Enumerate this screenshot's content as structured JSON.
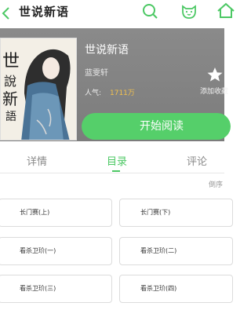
{
  "header": {
    "title": "世说新语"
  },
  "book": {
    "title": "世说新语",
    "author": "蓝雯轩",
    "popularity_label": "人气:",
    "popularity_value": "1711万",
    "favorite_label": "添加收藏",
    "cover_text": "世說新語"
  },
  "actions": {
    "read_label": "开始阅读"
  },
  "tabs": [
    {
      "label": "详情",
      "active": false
    },
    {
      "label": "目录",
      "active": true
    },
    {
      "label": "评论",
      "active": false
    }
  ],
  "toc": {
    "sort_label": "倒序",
    "chapters": [
      "长门赛(上)",
      "长门赛(下)",
      "看杀卫玠(一)",
      "看杀卫玠(二)",
      "看杀卫玠(三)",
      "看杀卫玠(四)"
    ]
  },
  "colors": {
    "accent": "#4cc864",
    "button": "#55cf6a",
    "popularity": "#f2c14e"
  },
  "icons": [
    "back-icon",
    "search-icon",
    "mascot-icon",
    "home-icon",
    "star-icon"
  ]
}
